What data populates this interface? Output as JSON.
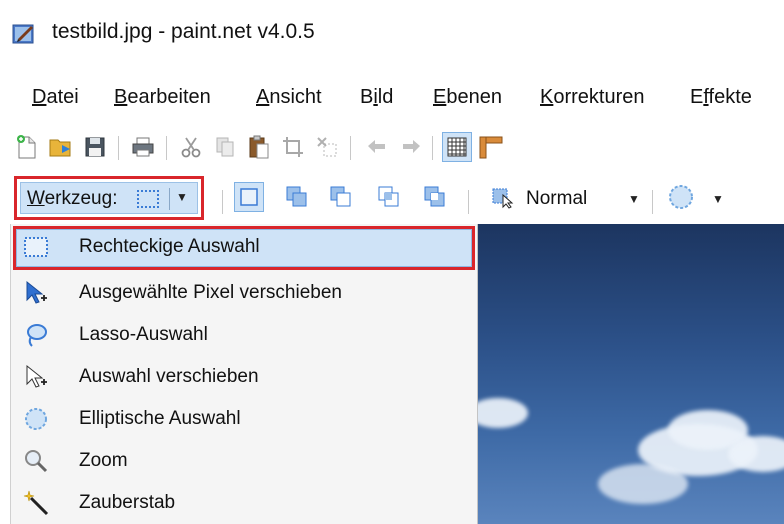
{
  "window": {
    "title": "testbild.jpg - paint.net v4.0.5"
  },
  "menu": [
    {
      "label": "Datei",
      "ul": "D",
      "rest": "atei"
    },
    {
      "label": "Bearbeiten",
      "ul": "B",
      "rest": "earbeiten"
    },
    {
      "label": "Ansicht",
      "ul": "A",
      "rest": "nsicht"
    },
    {
      "label": "Bild",
      "pre": "B",
      "ul": "i",
      "rest": "ld"
    },
    {
      "label": "Ebenen",
      "ul": "E",
      "rest": "benen"
    },
    {
      "label": "Korrekturen",
      "ul": "K",
      "rest": "orrekturen"
    },
    {
      "label": "Effekte",
      "pre": "E",
      "ul": "f",
      "rest": "fekte"
    }
  ],
  "toolbar": {
    "tool_label_underlined": "W",
    "tool_label_rest": "erkzeug:",
    "blend_mode": "Normal"
  },
  "tools": [
    {
      "label": "Rechteckige Auswahl",
      "icon": "rectangle-select-icon",
      "selected": true
    },
    {
      "label": "Ausgewählte Pixel verschieben",
      "icon": "move-pixels-icon",
      "selected": false
    },
    {
      "label": "Lasso-Auswahl",
      "icon": "lasso-icon",
      "selected": false
    },
    {
      "label": "Auswahl verschieben",
      "icon": "move-selection-icon",
      "selected": false
    },
    {
      "label": "Elliptische Auswahl",
      "icon": "ellipse-select-icon",
      "selected": false
    },
    {
      "label": "Zoom",
      "icon": "zoom-icon",
      "selected": false
    },
    {
      "label": "Zauberstab",
      "icon": "magic-wand-icon",
      "selected": false
    }
  ],
  "colors": {
    "highlight": "#d9262b",
    "selection": "#cfe3f7",
    "accent": "#3a7bd5"
  }
}
